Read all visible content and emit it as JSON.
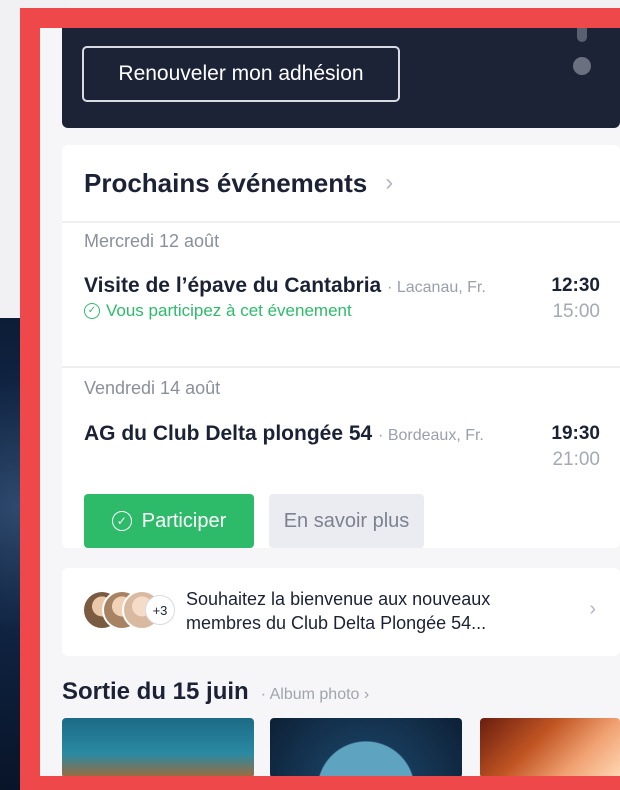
{
  "header": {
    "renew_label": "Renouveler mon adhésion"
  },
  "events": {
    "title": "Prochains événements",
    "chevron": "›",
    "items": [
      {
        "date": "Mercredi 12 août",
        "title": "Visite de l’épave du Cantabria",
        "location": "· Lacanau, Fr.",
        "start": "12:30",
        "end": "15:00",
        "status": "Vous participez à cet évenement"
      },
      {
        "date": "Vendredi 14 août",
        "title": "AG du Club Delta plongée 54",
        "location": "· Bordeaux, Fr.",
        "start": "19:30",
        "end": "21:00",
        "participate_label": "Participer",
        "more_label": "En savoir plus"
      }
    ]
  },
  "welcome": {
    "more_count": "+3",
    "text": "Souhaitez la bienvenue aux nouveaux membres du Club Delta Plongée 54...",
    "chevron": "›"
  },
  "album": {
    "title": "Sortie du 15 juin",
    "subtitle": "· Album photo ›"
  },
  "colors": {
    "frame": "#ef484b",
    "header_bg": "#1d2336",
    "accent_green": "#2dbb6a"
  },
  "icons": {
    "check": "check-circle-icon",
    "chevron": "chevron-right-icon"
  }
}
